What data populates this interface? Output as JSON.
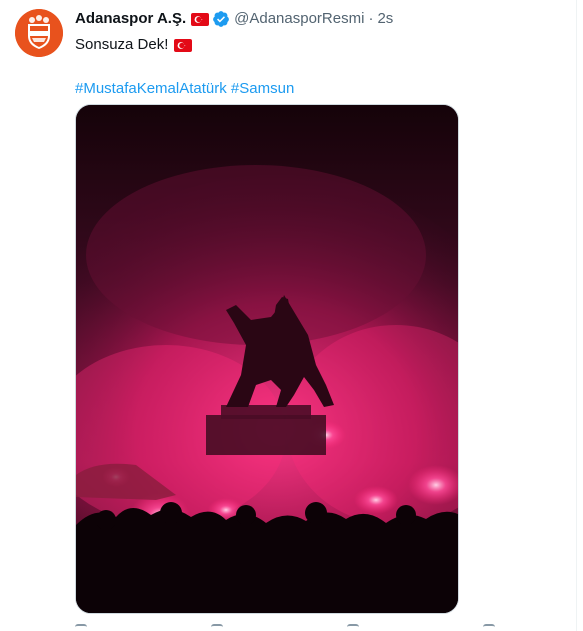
{
  "tweet": {
    "author": {
      "name": "Adanaspor A.Ş.",
      "handle": "@AdanasporResmi",
      "separator": "·",
      "time": "2s",
      "verified": true,
      "flag": "turkey-flag-icon"
    },
    "text": "Sonsuza Dek!",
    "text_flag": "turkey-flag-icon",
    "hashtags": [
      "#MustafaKemalAtatürk",
      "#Samsun"
    ],
    "media": {
      "kind": "photo"
    }
  },
  "icons": {
    "avatar": "adanaspor-logo-icon",
    "verified": "verified-badge-icon",
    "actions": [
      "reply-icon",
      "retweet-icon",
      "like-icon",
      "share-icon"
    ]
  },
  "colors": {
    "link": "#1d9bf0",
    "secondary_text": "#536471",
    "avatar_bg": "#e8521d",
    "verified": "#1d9bf0",
    "flag_red": "#e30a17",
    "photo_magenta": "#ff2a7a"
  }
}
